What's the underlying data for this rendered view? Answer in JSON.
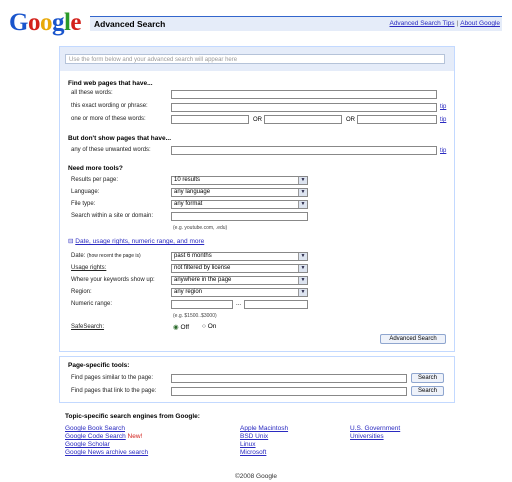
{
  "logo": "Google",
  "header": {
    "title": "Advanced Search",
    "tips_link": "Advanced Search Tips",
    "separator": "|",
    "about_link": "About Google"
  },
  "query_box": {
    "placeholder": "Use the form below and your advanced search will appear here"
  },
  "find_section": {
    "heading": "Find web pages that have...",
    "all_words": "all these words:",
    "exact_phrase": "this exact wording or phrase:",
    "one_or_more": "one or more of these words:",
    "or_label": "OR",
    "tip": "tip"
  },
  "exclude_section": {
    "heading": "But don't show pages that have...",
    "unwanted": "any of these unwanted words:",
    "tip": "tip"
  },
  "tools_section": {
    "heading": "Need more tools?",
    "results_label": "Results per page:",
    "results_value": "10 results",
    "language_label": "Language:",
    "language_value": "any language",
    "filetype_label": "File type:",
    "filetype_value": "any format",
    "site_label": "Search within a site or domain:",
    "site_hint": "(e.g. youtube.com, .edu)"
  },
  "more_section": {
    "toggle": "⊟",
    "link": "Date, usage rights, numeric range, and more",
    "date_label": "Date:",
    "date_sub": "(how recent the page is)",
    "date_value": "past 6 months",
    "usage_label": "Usage rights:",
    "usage_value": "not filtered by license",
    "where_label": "Where your keywords show up:",
    "where_value": "anywhere in the page",
    "region_label": "Region:",
    "region_value": "any region",
    "numeric_label": "Numeric range:",
    "range_sep": "...",
    "numeric_hint": "(e.g. $1500..$3000)",
    "safesearch_label": "SafeSearch:",
    "off_label": "Off",
    "on_label": "On"
  },
  "submit_button": "Advanced Search",
  "page_tools": {
    "heading": "Page-specific tools:",
    "similar_label": "Find pages similar to the page:",
    "link_label": "Find pages that link to the page:",
    "search_button": "Search"
  },
  "topic": {
    "heading": "Topic-specific search engines from Google:",
    "col1": [
      "Google Book Search",
      "Google Code Search",
      "Google Scholar",
      "Google News archive search"
    ],
    "new_badge": "New!",
    "col2": [
      "Apple Macintosh",
      "BSD Unix",
      "Linux",
      "Microsoft"
    ],
    "col3": [
      "U.S. Government",
      "Universities"
    ]
  },
  "footer": {
    "copyright": "©2008 Google"
  },
  "colors": {
    "header_bg": "#e5ecf9",
    "border": "#c3d9ff",
    "link": "#2a2ac0",
    "new_badge": "#d3211b"
  }
}
